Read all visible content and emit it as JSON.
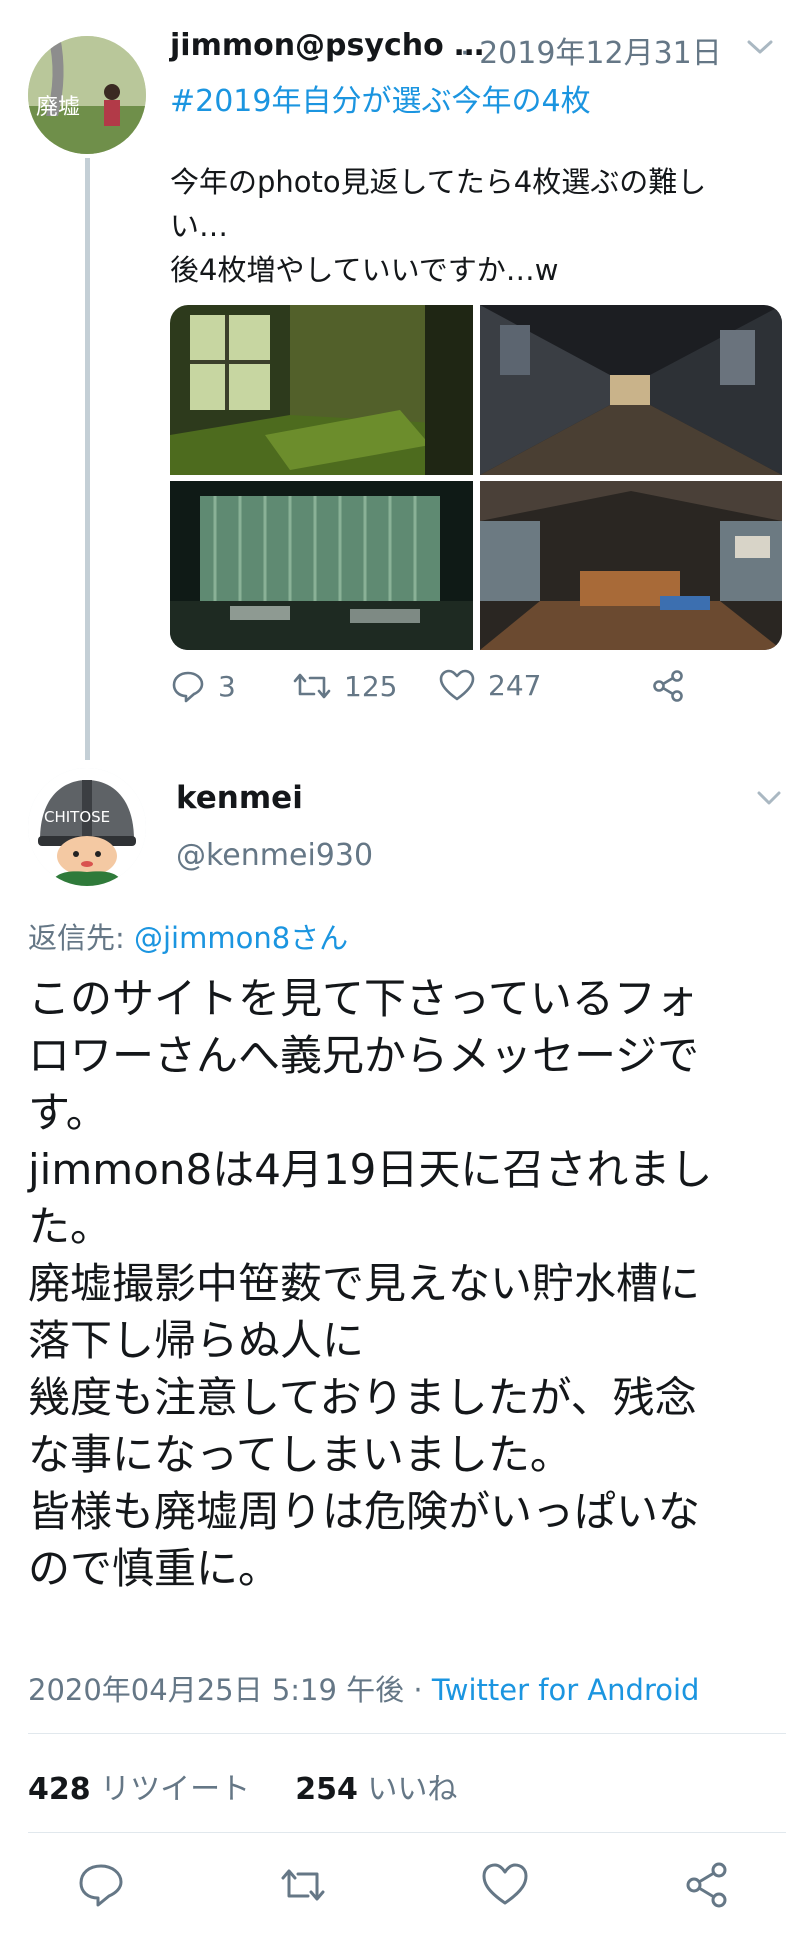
{
  "tweet1": {
    "display_name": "jimmon@psycho …",
    "date": "· 2019年12月31日",
    "hashtag": "#2019年自分が選ぶ今年の4枚",
    "body_lines": [
      "今年のphoto見返してたら4枚選ぶの難し",
      "い…",
      "後4枚増やしていいですか…w"
    ],
    "avatar_text": "廃墟",
    "replies": "3",
    "retweets": "125",
    "likes": "247",
    "photos": [
      {
        "name": "mossy-room-photo"
      },
      {
        "name": "dark-corridor-photo"
      },
      {
        "name": "green-curtain-hall-photo"
      },
      {
        "name": "wooden-workshop-photo"
      }
    ]
  },
  "tweet2": {
    "display_name": "kenmei",
    "handle": "@kenmei930",
    "avatar_text": "CHITOSE",
    "reply_prefix": "返信先: ",
    "reply_to": "@jimmon8さん",
    "body_lines": [
      "このサイトを見て下さっているフォ",
      "ロワーさんへ義兄からメッセージで",
      "す。",
      "jimmon8は4月19日天に召されまし",
      "た。",
      "廃墟撮影中笹薮で見えない貯水槽に",
      "落下し帰らぬ人に",
      "幾度も注意しておりましたが、残念",
      "な事になってしまいました。",
      "皆様も廃墟周りは危険がいっぱいな",
      "ので慎重に。"
    ],
    "timestamp": "2020年04月25日 5:19 午後 · ",
    "source": "Twitter for Android",
    "retweet_count": "428",
    "retweet_label": " リツイート",
    "like_count": "254",
    "like_label": " いいね"
  },
  "colors": {
    "link": "#1b95e0",
    "muted": "#657786",
    "text": "#14171a",
    "divider": "#e1e8ed"
  },
  "icons": [
    "reply-icon",
    "retweet-icon",
    "like-icon",
    "share-icon",
    "chevron-down-icon"
  ]
}
